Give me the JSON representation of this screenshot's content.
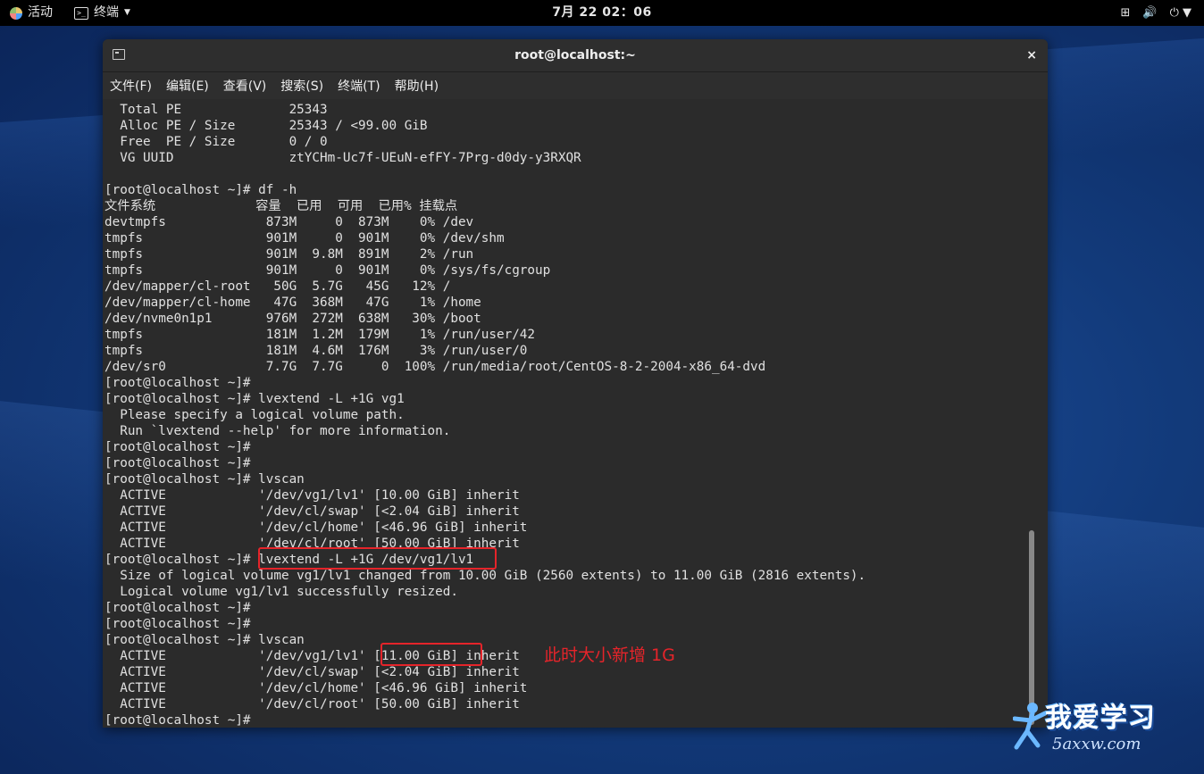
{
  "topbar": {
    "activities": "活动",
    "app_menu": "终端",
    "clock": "7月 22  02：06"
  },
  "window": {
    "title": "root@localhost:~",
    "close_glyph": "×",
    "menu": [
      "文件(F)",
      "编辑(E)",
      "查看(V)",
      "搜索(S)",
      "终端(T)",
      "帮助(H)"
    ]
  },
  "terminal": {
    "lines": [
      "  Total PE              25343",
      "  Alloc PE / Size       25343 / <99.00 GiB",
      "  Free  PE / Size       0 / 0",
      "  VG UUID               ztYCHm-Uc7f-UEuN-efFY-7Prg-d0dy-y3RXQR",
      "",
      "[root@localhost ~]# df -h",
      "文件系统             容量  已用  可用  已用% 挂载点",
      "devtmpfs             873M     0  873M    0% /dev",
      "tmpfs                901M     0  901M    0% /dev/shm",
      "tmpfs                901M  9.8M  891M    2% /run",
      "tmpfs                901M     0  901M    0% /sys/fs/cgroup",
      "/dev/mapper/cl-root   50G  5.7G   45G   12% /",
      "/dev/mapper/cl-home   47G  368M   47G    1% /home",
      "/dev/nvme0n1p1       976M  272M  638M   30% /boot",
      "tmpfs                181M  1.2M  179M    1% /run/user/42",
      "tmpfs                181M  4.6M  176M    3% /run/user/0",
      "/dev/sr0             7.7G  7.7G     0  100% /run/media/root/CentOS-8-2-2004-x86_64-dvd",
      "[root@localhost ~]#",
      "[root@localhost ~]# lvextend -L +1G vg1",
      "  Please specify a logical volume path.",
      "  Run `lvextend --help' for more information.",
      "[root@localhost ~]#",
      "[root@localhost ~]#",
      "[root@localhost ~]# lvscan",
      "  ACTIVE            '/dev/vg1/lv1' [10.00 GiB] inherit",
      "  ACTIVE            '/dev/cl/swap' [<2.04 GiB] inherit",
      "  ACTIVE            '/dev/cl/home' [<46.96 GiB] inherit",
      "  ACTIVE            '/dev/cl/root' [50.00 GiB] inherit",
      "[root@localhost ~]# lvextend -L +1G /dev/vg1/lv1",
      "  Size of logical volume vg1/lv1 changed from 10.00 GiB (2560 extents) to 11.00 GiB (2816 extents).",
      "  Logical volume vg1/lv1 successfully resized.",
      "[root@localhost ~]#",
      "[root@localhost ~]#",
      "[root@localhost ~]# lvscan",
      "  ACTIVE            '/dev/vg1/lv1' [11.00 GiB] inherit",
      "  ACTIVE            '/dev/cl/swap' [<2.04 GiB] inherit",
      "  ACTIVE            '/dev/cl/home' [<46.96 GiB] inherit",
      "  ACTIVE            '/dev/cl/root' [50.00 GiB] inherit",
      "[root@localhost ~]#"
    ]
  },
  "annotation": "此时大小新增 1G",
  "watermark": {
    "main": "我爱学习",
    "sub": "5axxw.com"
  },
  "colors": {
    "terminal_bg": "#2b2b2b",
    "terminal_fg": "#e0e0e0",
    "highlight": "#e5242a"
  }
}
